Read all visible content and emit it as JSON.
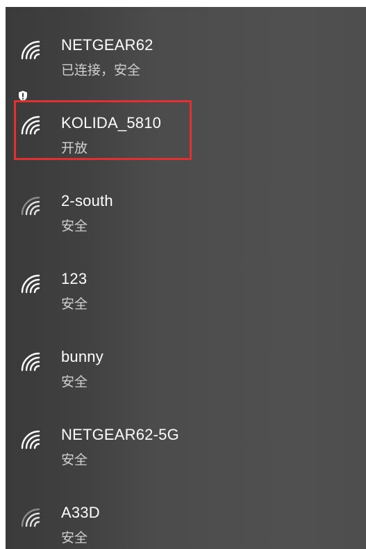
{
  "networks": [
    {
      "name": "NETGEAR62",
      "status": "已连接，安全",
      "icon": "wifi-icon",
      "connected": true,
      "open": false
    },
    {
      "name": "KOLIDA_5810",
      "status": "开放",
      "icon": "wifi-icon",
      "warning_icon": "shield-warning-icon",
      "connected": false,
      "open": true,
      "highlighted": true
    },
    {
      "name": "2-south",
      "status": "安全",
      "icon": "wifi-icon",
      "connected": false,
      "open": false
    },
    {
      "name": "123",
      "status": "安全",
      "icon": "wifi-icon",
      "connected": false,
      "open": false
    },
    {
      "name": "bunny",
      "status": "安全",
      "icon": "wifi-icon",
      "connected": false,
      "open": false
    },
    {
      "name": "NETGEAR62-5G",
      "status": "安全",
      "icon": "wifi-icon",
      "connected": false,
      "open": false
    },
    {
      "name": "A33D",
      "status": "安全",
      "icon": "wifi-icon",
      "connected": false,
      "open": false
    }
  ],
  "colors": {
    "panel_background": "#4a4a4a",
    "text_primary": "#ffffff",
    "text_secondary": "#d0d0d0",
    "highlight_border": "#e03030"
  }
}
